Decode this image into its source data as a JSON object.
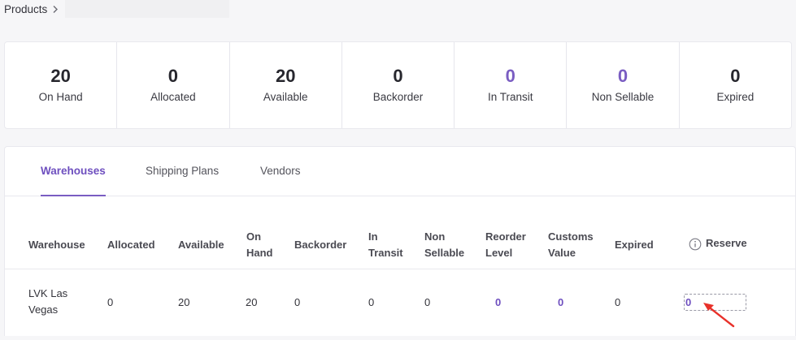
{
  "breadcrumb": {
    "root": "Products"
  },
  "stats": [
    {
      "value": "20",
      "label": "On Hand"
    },
    {
      "value": "0",
      "label": "Allocated"
    },
    {
      "value": "20",
      "label": "Available"
    },
    {
      "value": "0",
      "label": "Backorder"
    },
    {
      "value": "0",
      "label": "In Transit",
      "accent": "#7a5dc2"
    },
    {
      "value": "0",
      "label": "Non Sellable",
      "accent": "#7a5dc2"
    },
    {
      "value": "0",
      "label": "Expired"
    }
  ],
  "tabs": [
    {
      "label": "Warehouses",
      "active": true
    },
    {
      "label": "Shipping Plans"
    },
    {
      "label": "Vendors"
    }
  ],
  "table": {
    "headers": {
      "warehouse": "Warehouse",
      "allocated": "Allocated",
      "available": "Available",
      "on_hand_1": "On",
      "on_hand_2": "Hand",
      "backorder": "Backorder",
      "in_transit_1": "In",
      "in_transit_2": "Transit",
      "non_sellable_1": "Non",
      "non_sellable_2": "Sellable",
      "reorder_level_1": "Reorder",
      "reorder_level_2": "Level",
      "customs_value_1": "Customs",
      "customs_value_2": "Value",
      "expired": "Expired",
      "reserve": "Reserve"
    },
    "rows": [
      {
        "warehouse_1": "LVK Las",
        "warehouse_2": "Vegas",
        "allocated": "0",
        "available": "20",
        "on_hand": "20",
        "backorder": "0",
        "in_transit": "0",
        "non_sellable": "0",
        "reorder_level": "0",
        "customs_value": "0",
        "expired": "0",
        "reserve": "0"
      }
    ]
  },
  "colors": {
    "accent": "#7a5dc2",
    "annotation_arrow": "#e8312a"
  }
}
